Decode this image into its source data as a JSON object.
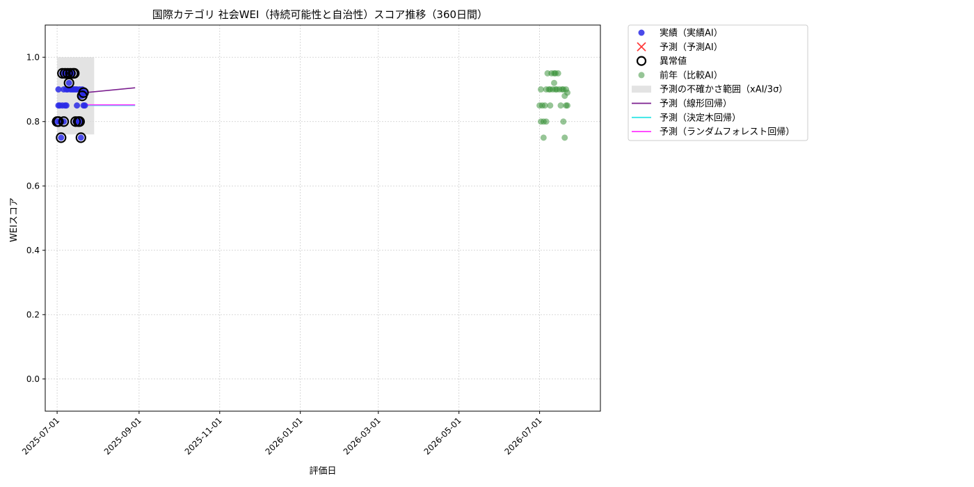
{
  "chart_data": {
    "type": "scatter",
    "title": "国際カテゴリ 社会WEI（持続可能性と自治性）スコア推移（360日間）",
    "xlabel": "評価日",
    "ylabel": "WEIスコア",
    "ylim": [
      -0.1,
      1.1
    ],
    "yticks": [
      "0.0",
      "0.2",
      "0.4",
      "0.6",
      "0.8",
      "1.0"
    ],
    "xlim": [
      "2025-06-22",
      "2026-08-16"
    ],
    "xticks": [
      "2025-07-01",
      "2025-09-01",
      "2025-11-01",
      "2026-01-01",
      "2026-03-01",
      "2026-05-01",
      "2026-07-01"
    ],
    "grid": true,
    "legend_position": "outside-right",
    "legend": [
      {
        "key": "actual",
        "label": "実績（実績AI）"
      },
      {
        "key": "predicted",
        "label": "予測（予測AI）"
      },
      {
        "key": "anomaly",
        "label": "異常値"
      },
      {
        "key": "previous_year",
        "label": "前年（比較AI）"
      },
      {
        "key": "uncertainty",
        "label": "予測の不確かさ範囲（xAI/3σ）"
      },
      {
        "key": "linear",
        "label": "予測（線形回帰）"
      },
      {
        "key": "tree",
        "label": "予測（決定木回帰）"
      },
      {
        "key": "forest",
        "label": "予測（ランダムフォレスト回帰）"
      }
    ],
    "colors": {
      "actual": "#2a2ae6",
      "predicted": "#ff3b3b",
      "anomaly": "#000000",
      "previous_year": "#2e8b2e",
      "uncertainty": "#d9d9d9",
      "linear": "#7b1f8f",
      "tree": "#33e6e6",
      "forest": "#ff33ff"
    },
    "uncertainty_band": {
      "x": [
        "2025-07-01",
        "2025-07-29"
      ],
      "y": [
        0.76,
        1.0
      ]
    },
    "series": [
      {
        "key": "actual",
        "points": [
          [
            "2025-07-01",
            0.8
          ],
          [
            "2025-07-02",
            0.85
          ],
          [
            "2025-07-02",
            0.9
          ],
          [
            "2025-07-03",
            0.8
          ],
          [
            "2025-07-03",
            0.85
          ],
          [
            "2025-07-04",
            0.75
          ],
          [
            "2025-07-04",
            0.8
          ],
          [
            "2025-07-05",
            0.85
          ],
          [
            "2025-07-05",
            0.95
          ],
          [
            "2025-07-06",
            0.8
          ],
          [
            "2025-07-06",
            0.9
          ],
          [
            "2025-07-07",
            0.85
          ],
          [
            "2025-07-07",
            0.95
          ],
          [
            "2025-07-08",
            0.85
          ],
          [
            "2025-07-08",
            0.9
          ],
          [
            "2025-07-09",
            0.9
          ],
          [
            "2025-07-09",
            0.95
          ],
          [
            "2025-07-10",
            0.92
          ],
          [
            "2025-07-10",
            0.95
          ],
          [
            "2025-07-11",
            0.9
          ],
          [
            "2025-07-11",
            0.95
          ],
          [
            "2025-07-12",
            0.9
          ],
          [
            "2025-07-12",
            0.95
          ],
          [
            "2025-07-13",
            0.9
          ],
          [
            "2025-07-13",
            0.95
          ],
          [
            "2025-07-14",
            0.9
          ],
          [
            "2025-07-15",
            0.8
          ],
          [
            "2025-07-15",
            0.9
          ],
          [
            "2025-07-16",
            0.85
          ],
          [
            "2025-07-16",
            0.9
          ],
          [
            "2025-07-17",
            0.8
          ],
          [
            "2025-07-18",
            0.8
          ],
          [
            "2025-07-18",
            0.9
          ],
          [
            "2025-07-19",
            0.75
          ],
          [
            "2025-07-19",
            0.88
          ],
          [
            "2025-07-20",
            0.88
          ],
          [
            "2025-07-20",
            0.9
          ],
          [
            "2025-07-21",
            0.85
          ],
          [
            "2025-07-21",
            0.89
          ],
          [
            "2025-07-22",
            0.85
          ],
          [
            "2025-07-22",
            0.89
          ]
        ]
      },
      {
        "key": "anomaly",
        "points": [
          [
            "2025-07-01",
            0.8
          ],
          [
            "2025-07-02",
            0.8
          ],
          [
            "2025-07-04",
            0.75
          ],
          [
            "2025-07-05",
            0.95
          ],
          [
            "2025-07-06",
            0.8
          ],
          [
            "2025-07-07",
            0.95
          ],
          [
            "2025-07-09",
            0.95
          ],
          [
            "2025-07-10",
            0.92
          ],
          [
            "2025-07-11",
            0.95
          ],
          [
            "2025-07-13",
            0.95
          ],
          [
            "2025-07-14",
            0.95
          ],
          [
            "2025-07-15",
            0.8
          ],
          [
            "2025-07-17",
            0.8
          ],
          [
            "2025-07-18",
            0.8
          ],
          [
            "2025-07-19",
            0.75
          ],
          [
            "2025-07-20",
            0.88
          ],
          [
            "2025-07-21",
            0.89
          ]
        ]
      },
      {
        "key": "previous_year",
        "points": [
          [
            "2026-07-01",
            0.85
          ],
          [
            "2026-07-02",
            0.8
          ],
          [
            "2026-07-02",
            0.9
          ],
          [
            "2026-07-03",
            0.85
          ],
          [
            "2026-07-04",
            0.75
          ],
          [
            "2026-07-04",
            0.8
          ],
          [
            "2026-07-05",
            0.85
          ],
          [
            "2026-07-06",
            0.8
          ],
          [
            "2026-07-06",
            0.9
          ],
          [
            "2026-07-07",
            0.95
          ],
          [
            "2026-07-08",
            0.9
          ],
          [
            "2026-07-09",
            0.85
          ],
          [
            "2026-07-09",
            0.9
          ],
          [
            "2026-07-10",
            0.95
          ],
          [
            "2026-07-11",
            0.9
          ],
          [
            "2026-07-12",
            0.92
          ],
          [
            "2026-07-12",
            0.95
          ],
          [
            "2026-07-13",
            0.9
          ],
          [
            "2026-07-13",
            0.95
          ],
          [
            "2026-07-14",
            0.9
          ],
          [
            "2026-07-15",
            0.95
          ],
          [
            "2026-07-16",
            0.9
          ],
          [
            "2026-07-17",
            0.85
          ],
          [
            "2026-07-18",
            0.9
          ],
          [
            "2026-07-19",
            0.8
          ],
          [
            "2026-07-19",
            0.9
          ],
          [
            "2026-07-20",
            0.75
          ],
          [
            "2026-07-20",
            0.88
          ],
          [
            "2026-07-21",
            0.9
          ],
          [
            "2026-07-21",
            0.85
          ],
          [
            "2026-07-22",
            0.89
          ],
          [
            "2026-07-22",
            0.85
          ]
        ]
      },
      {
        "key": "linear",
        "line": [
          [
            "2025-07-22",
            0.89
          ],
          [
            "2025-08-29",
            0.905
          ]
        ]
      },
      {
        "key": "tree",
        "line": [
          [
            "2025-07-22",
            0.85
          ],
          [
            "2025-08-29",
            0.85
          ]
        ]
      },
      {
        "key": "forest",
        "line": [
          [
            "2025-07-22",
            0.852
          ],
          [
            "2025-08-29",
            0.852
          ]
        ]
      }
    ]
  }
}
